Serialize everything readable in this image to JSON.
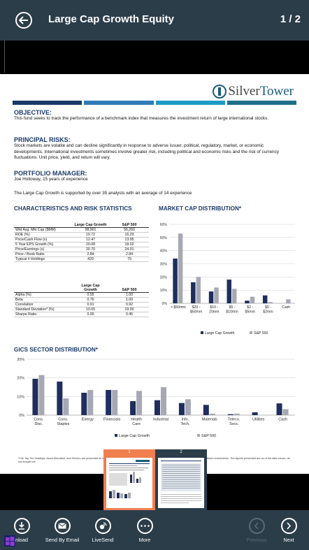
{
  "header": {
    "title": "Large Cap Growth Equity",
    "page_count": "1 / 2"
  },
  "doc": {
    "logo_part1": "Silver",
    "logo_part2": "Tower",
    "objective": {
      "head": "OBJECTIVE:",
      "text": "This fund seeks to track the performance of a benchmark index that measures the investment return of large international stocks."
    },
    "risks": {
      "head": "PRINCIPAL RISKS:",
      "text": "Stock markets are volatile and can decline significantly in response to adverse issuer, political, regulatory, market, or economic developments.  International investments sometimes involve greater risk, including political and economic risks and the risk of currency fluctuations.  Unit price, yield, and return will vary."
    },
    "manager": {
      "head": "PORTFOLIO MANAGER:",
      "text": "Joe Holloway, 15 years of experience"
    },
    "support_text": "The Large Cap Growth is supported by over 35  analysts with an average of 14 experience",
    "char_head": "CHARACTERISTICS AND RISK STATISTICS",
    "mkt_head": "MARKET CAP DISTRIBUTION*",
    "gics_head": "GICS SECTOR DISTRIBUTION*",
    "table1": {
      "col1": "Large Cap Growth",
      "col2": "S&P 500",
      "rows": [
        [
          "Wtd Avg. Mkt Cap ($MM)",
          "98,901",
          "56,260"
        ],
        [
          "ROE (%)",
          "19.72",
          "16.29"
        ],
        [
          "Price/Cash Flow (x)",
          "12.47",
          "13.95"
        ],
        [
          "5 Year EPS Growth (%)",
          "20.08",
          "18.02"
        ],
        [
          "Price/Earnings (x)",
          "20.70",
          "24.01"
        ],
        [
          "Price / Book Ratio",
          "2.84",
          "2.84"
        ],
        [
          "Typical # Holdings",
          "420",
          "79"
        ]
      ]
    },
    "table2": {
      "col1a": "Large Cap",
      "col1b": "Growth",
      "col2": "S&P 500",
      "rows": [
        [
          "Alpha (%)",
          "0.55",
          "1.00"
        ],
        [
          "Beta",
          "0.76",
          "1.00"
        ],
        [
          "Correlation",
          "0.91",
          "0.92"
        ],
        [
          "Standard Deviation* (%)",
          "10.05",
          "19.00"
        ],
        [
          "Sharpe Ratio",
          "0.00",
          "0.45"
        ]
      ]
    },
    "footnote": "*The Top Ten Holdings, Asset Allocation, and Sectors are presented as of the date shown and are subject to change and may not be representative of current or future investments. The figures presented are as of the date shown, do not include the"
  },
  "chart_data": [
    {
      "type": "bar",
      "categories": [
        "> $50mm",
        "$20 - $50mm",
        "$10 - 20mm",
        "$5 - $10mm",
        "$2 - $5mm",
        "$0 - $2mm",
        "Cash"
      ],
      "series": [
        {
          "name": "Large Cap Growth",
          "values": [
            34,
            16,
            9,
            18,
            2,
            6
          ]
        },
        {
          "name": "S&P 500",
          "values": [
            53,
            20,
            12,
            11,
            5,
            1,
            3
          ]
        }
      ],
      "ylim": [
        0,
        60
      ],
      "yticks": [
        "0%",
        "10%",
        "20%",
        "30%",
        "40%",
        "50%",
        "60%"
      ],
      "legend_position": "bottom",
      "colors": {
        "Large Cap Growth": "#1f2e5c",
        "S&P 500": "#a6a9b4"
      }
    },
    {
      "type": "bar",
      "categories": [
        "Cons. Disc.",
        "Cons. Staples",
        "Energy",
        "Financials",
        "Health Care",
        "Industrial",
        "Info. Tech.",
        "Materials",
        "Teleco. Svcs.",
        "Utilities",
        "Cash"
      ],
      "series": [
        {
          "name": "Large Cap Growth",
          "values": [
            19.5,
            18,
            12,
            13.5,
            7.5,
            8,
            6.5,
            5.5,
            0.5,
            1.5,
            6.3
          ]
        },
        {
          "name": "S&P 500",
          "values": [
            21.5,
            9,
            13.5,
            13.5,
            13,
            15,
            8.5,
            0.8,
            0.8,
            0,
            3.2
          ]
        }
      ],
      "ylim": [
        0,
        30
      ],
      "yticks": [
        "0%",
        "10%",
        "20%",
        "30%"
      ],
      "legend_position": "bottom",
      "colors": {
        "Large Cap Growth": "#1f2e5c",
        "S&P 500": "#a6a9b4"
      }
    }
  ],
  "thumbs": [
    {
      "label": "1",
      "active": true
    },
    {
      "label": "2",
      "active": false
    }
  ],
  "bottom": {
    "download": "nload",
    "email": "Send By Email",
    "livesend": "LiveSend",
    "more": "More",
    "previous": "Previous",
    "next": "Next"
  },
  "colors": {
    "header": "#2c3d4a",
    "accent": "#1a3a6a",
    "thumb_active": "#f07f4f"
  }
}
